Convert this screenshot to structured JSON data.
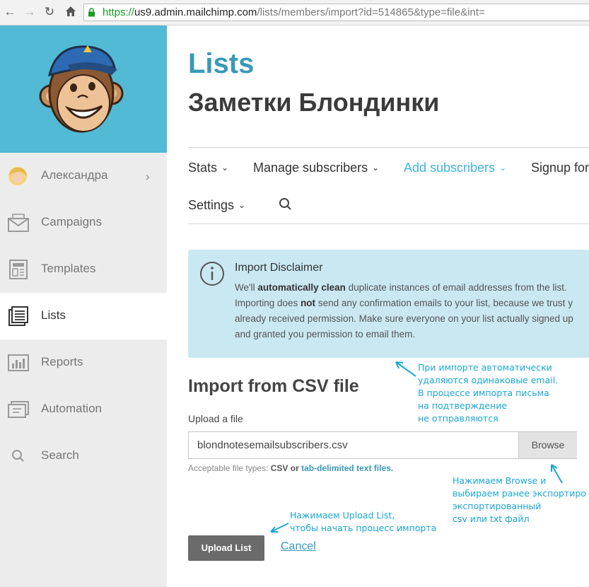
{
  "browser": {
    "url_https": "https://",
    "url_host": "us9.admin.mailchimp.com",
    "url_rest": "/lists/members/import?id=514865&type=file&int="
  },
  "sidebar": {
    "user_label": "Александра",
    "items": [
      {
        "label": "Campaigns",
        "icon": "envelope-icon"
      },
      {
        "label": "Templates",
        "icon": "template-icon"
      },
      {
        "label": "Lists",
        "icon": "list-icon",
        "active": true
      },
      {
        "label": "Reports",
        "icon": "bar-chart-icon"
      },
      {
        "label": "Automation",
        "icon": "automation-icon"
      },
      {
        "label": "Search",
        "icon": "search-icon"
      }
    ]
  },
  "header": {
    "section": "Lists",
    "list_name": "Заметки Блондинки"
  },
  "tabs": [
    {
      "label": "Stats"
    },
    {
      "label": "Manage subscribers"
    },
    {
      "label": "Add subscribers",
      "active": true
    },
    {
      "label": "Signup for"
    },
    {
      "label": "Settings"
    }
  ],
  "disclaimer": {
    "title": "Import Disclaimer",
    "line1_a": "We'll ",
    "line1_b": "automatically clean",
    "line1_c": " duplicate instances of email addresses from the list.",
    "line2_a": "Importing does ",
    "line2_b": "not",
    "line2_c": " send any confirmation emails to your list, because we trust y",
    "line3": "already received permission. Make sure everyone on your list actually signed up",
    "line4": "and granted you permission to email them."
  },
  "import": {
    "heading": "Import from CSV file",
    "upload_label": "Upload a file",
    "file_value": "blondnotesemailsubscribers.csv",
    "browse_label": "Browse",
    "hint_prefix": "Acceptable file types: ",
    "hint_csv": "CSV",
    "hint_or": " or ",
    "hint_tab": "tab-delimited text files."
  },
  "actions": {
    "upload_label": "Upload List",
    "cancel_label": "Cancel"
  },
  "annotations": {
    "note1": [
      "При импорте автоматически",
      "удаляются одинаковые email.",
      "В процессе импорта письма",
      "на подтверждение",
      "не отправляются"
    ],
    "note2": [
      "Нажимаем Browse и",
      "выбираем ранее экспортиро",
      "экспортированный",
      "csv или txt файл"
    ],
    "note3": [
      "Нажимаем Upload List,",
      "чтобы начать процесс импорта"
    ]
  },
  "colors": {
    "brand_blue": "#52bad5",
    "accent": "#3999b6",
    "annotation": "#1aa7d6"
  }
}
